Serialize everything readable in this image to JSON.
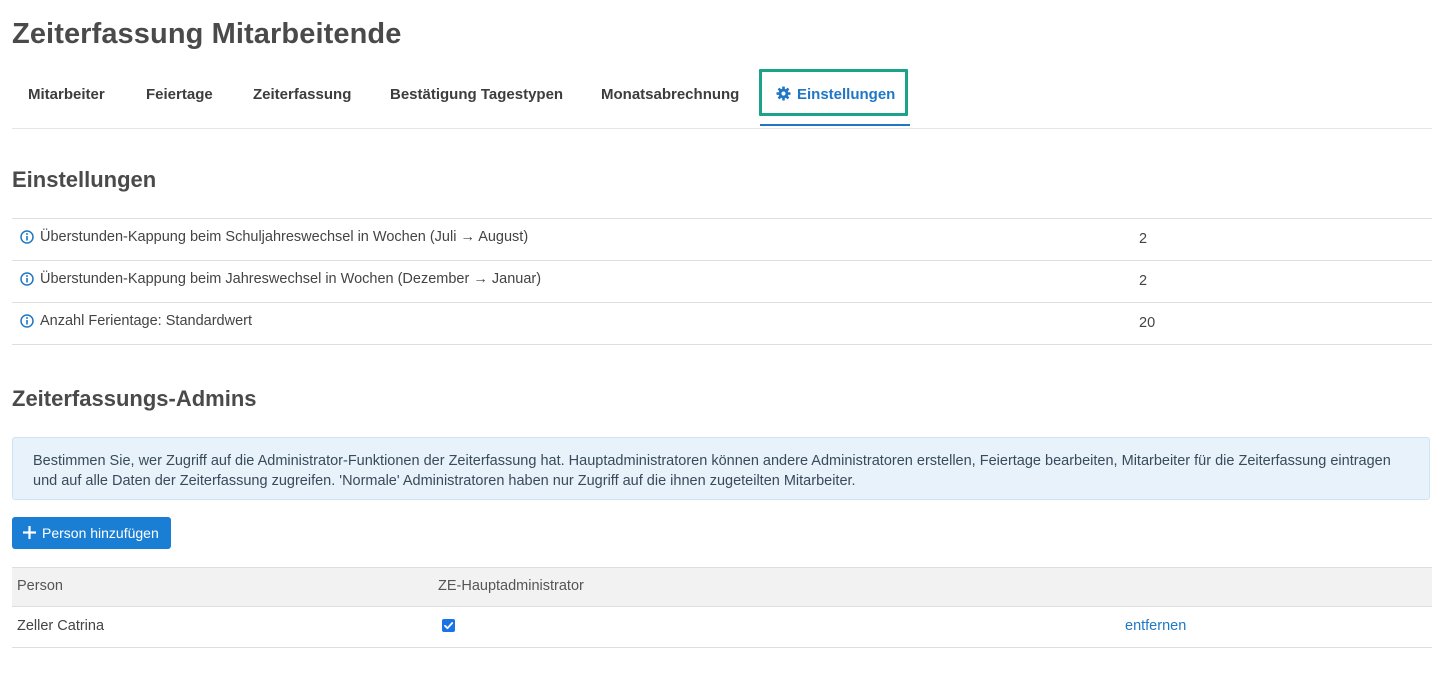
{
  "page": {
    "title": "Zeiterfassung Mitarbeitende"
  },
  "tabs": [
    {
      "label": "Mitarbeiter"
    },
    {
      "label": "Feiertage"
    },
    {
      "label": "Zeiterfassung"
    },
    {
      "label": "Bestätigung Tagestypen"
    },
    {
      "label": "Monatsabrechnung"
    },
    {
      "label": "Einstellungen",
      "icon": "gear-icon",
      "active": true
    }
  ],
  "settings": {
    "heading": "Einstellungen",
    "rows": [
      {
        "label": "Überstunden-Kappung beim Schuljahreswechsel in Wochen (Juli → August)",
        "value": "2",
        "icon": "info-icon"
      },
      {
        "label": "Überstunden-Kappung beim Jahreswechsel in Wochen (Dezember → Januar)",
        "value": "2",
        "icon": "info-icon"
      },
      {
        "label": "Anzahl Ferientage: Standardwert",
        "value": "20",
        "icon": "info-icon"
      }
    ]
  },
  "admins": {
    "heading": "Zeiterfassungs-Admins",
    "info_text": "Bestimmen Sie, wer Zugriff auf die Administrator-Funktionen der Zeiterfassung hat. Hauptadministratoren können andere Administratoren erstellen, Feiertage bearbeiten, Mitarbeiter für die Zeiterfassung eintragen und auf alle Daten der Zeiterfassung zugreifen. 'Normale' Administratoren haben nur Zugriff auf die ihnen zugeteilten Mitarbeiter.",
    "add_button_label": "Person hinzufügen",
    "columns": {
      "person": "Person",
      "main_admin": "ZE-Hauptadministrator"
    },
    "rows": [
      {
        "person": "Zeller Catrina",
        "main_admin": true,
        "action": "entfernen"
      }
    ]
  },
  "colors": {
    "accent": "#1f77c6",
    "button": "#1a7fd4",
    "focus_ring": "#1aa38a",
    "alert_bg": "#e7f2fb"
  }
}
